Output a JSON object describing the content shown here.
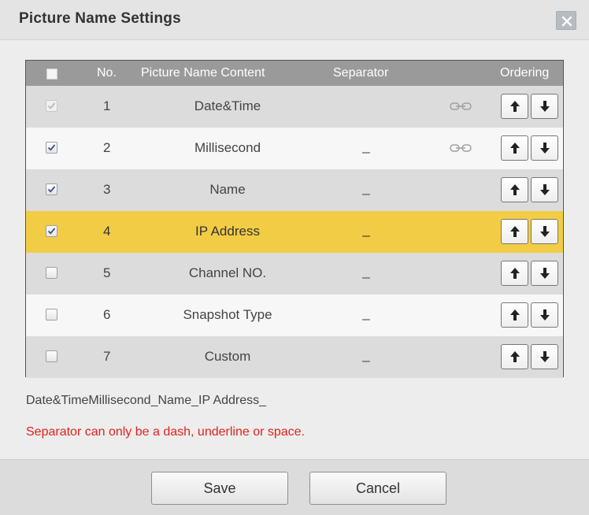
{
  "dialog": {
    "title": "Picture Name Settings"
  },
  "table": {
    "headers": {
      "no": "No.",
      "content": "Picture Name Content",
      "separator": "Separator",
      "ordering": "Ordering"
    },
    "rows": [
      {
        "no": "1",
        "content": "Date&Time",
        "separator": "",
        "checked": true,
        "disabled": true,
        "linked": true,
        "selected": false
      },
      {
        "no": "2",
        "content": "Millisecond",
        "separator": "_",
        "checked": true,
        "disabled": false,
        "linked": true,
        "selected": false
      },
      {
        "no": "3",
        "content": "Name",
        "separator": "_",
        "checked": true,
        "disabled": false,
        "linked": false,
        "selected": false
      },
      {
        "no": "4",
        "content": "IP Address",
        "separator": "_",
        "checked": true,
        "disabled": false,
        "linked": false,
        "selected": true
      },
      {
        "no": "5",
        "content": "Channel NO.",
        "separator": "_",
        "checked": false,
        "disabled": false,
        "linked": false,
        "selected": false
      },
      {
        "no": "6",
        "content": "Snapshot Type",
        "separator": "_",
        "checked": false,
        "disabled": false,
        "linked": false,
        "selected": false
      },
      {
        "no": "7",
        "content": "Custom",
        "separator": "_",
        "checked": false,
        "disabled": false,
        "linked": false,
        "selected": false
      }
    ]
  },
  "preview": {
    "filename": "Date&TimeMillisecond_Name_IP Address_"
  },
  "warning": {
    "text": "Separator can only be a dash, underline or space."
  },
  "buttons": {
    "save": "Save",
    "cancel": "Cancel"
  },
  "colors": {
    "selected_row": "#f3cc45",
    "header_bg": "#9a9a9a",
    "warning": "#e0221b"
  }
}
